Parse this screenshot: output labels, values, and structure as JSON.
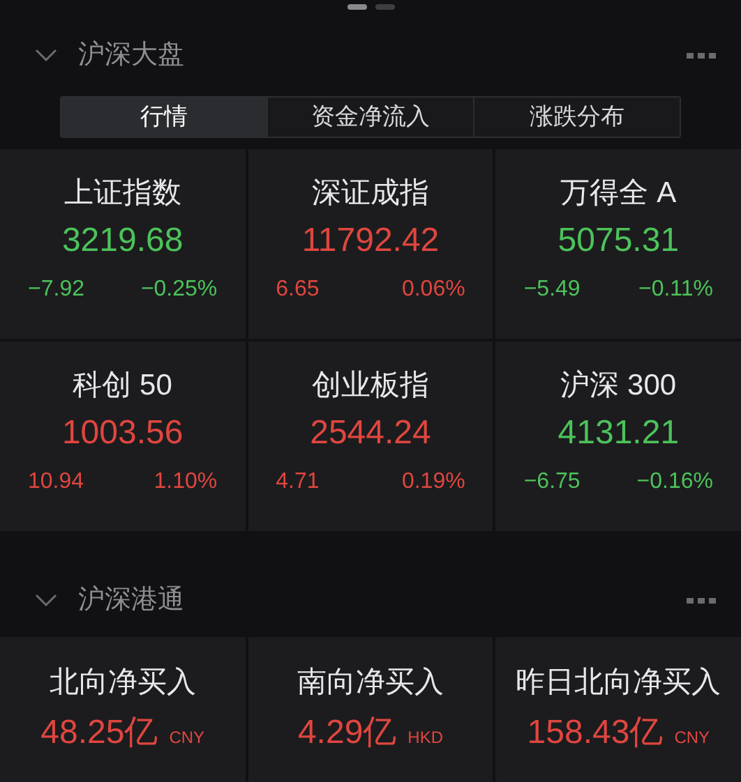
{
  "page_dots": [
    {
      "selected": true
    },
    {
      "selected": false
    }
  ],
  "sections": [
    {
      "title": "沪深大盘",
      "expanded": true,
      "tabs": [
        {
          "label": "行情",
          "selected": true
        },
        {
          "label": "资金净流入",
          "selected": false
        },
        {
          "label": "涨跌分布",
          "selected": false
        }
      ],
      "indices": [
        {
          "name": "上证指数",
          "value": "3219.68",
          "change": "−7.92",
          "percent": "−0.25%",
          "color": "#4cc35a"
        },
        {
          "name": "深证成指",
          "value": "11792.42",
          "change": "6.65",
          "percent": "0.06%",
          "color": "#e0463f"
        },
        {
          "name": "万得全 A",
          "value": "5075.31",
          "change": "−5.49",
          "percent": "−0.11%",
          "color": "#4cc35a"
        },
        {
          "name": "科创 50",
          "value": "1003.56",
          "change": "10.94",
          "percent": "1.10%",
          "color": "#e0463f"
        },
        {
          "name": "创业板指",
          "value": "2544.24",
          "change": "4.71",
          "percent": "0.19%",
          "color": "#e0463f"
        },
        {
          "name": "沪深 300",
          "value": "4131.21",
          "change": "−6.75",
          "percent": "−0.16%",
          "color": "#4cc35a"
        }
      ]
    },
    {
      "title": "沪深港通",
      "expanded": true,
      "flows": [
        {
          "name": "北向净买入",
          "value": "48.25亿",
          "currency": "CNY",
          "color": "#e0463f"
        },
        {
          "name": "南向净买入",
          "value": "4.29亿",
          "currency": "HKD",
          "color": "#e0463f"
        },
        {
          "name": "昨日北向净买入",
          "value": "158.43亿",
          "currency": "CNY",
          "color": "#e0463f"
        }
      ]
    }
  ]
}
